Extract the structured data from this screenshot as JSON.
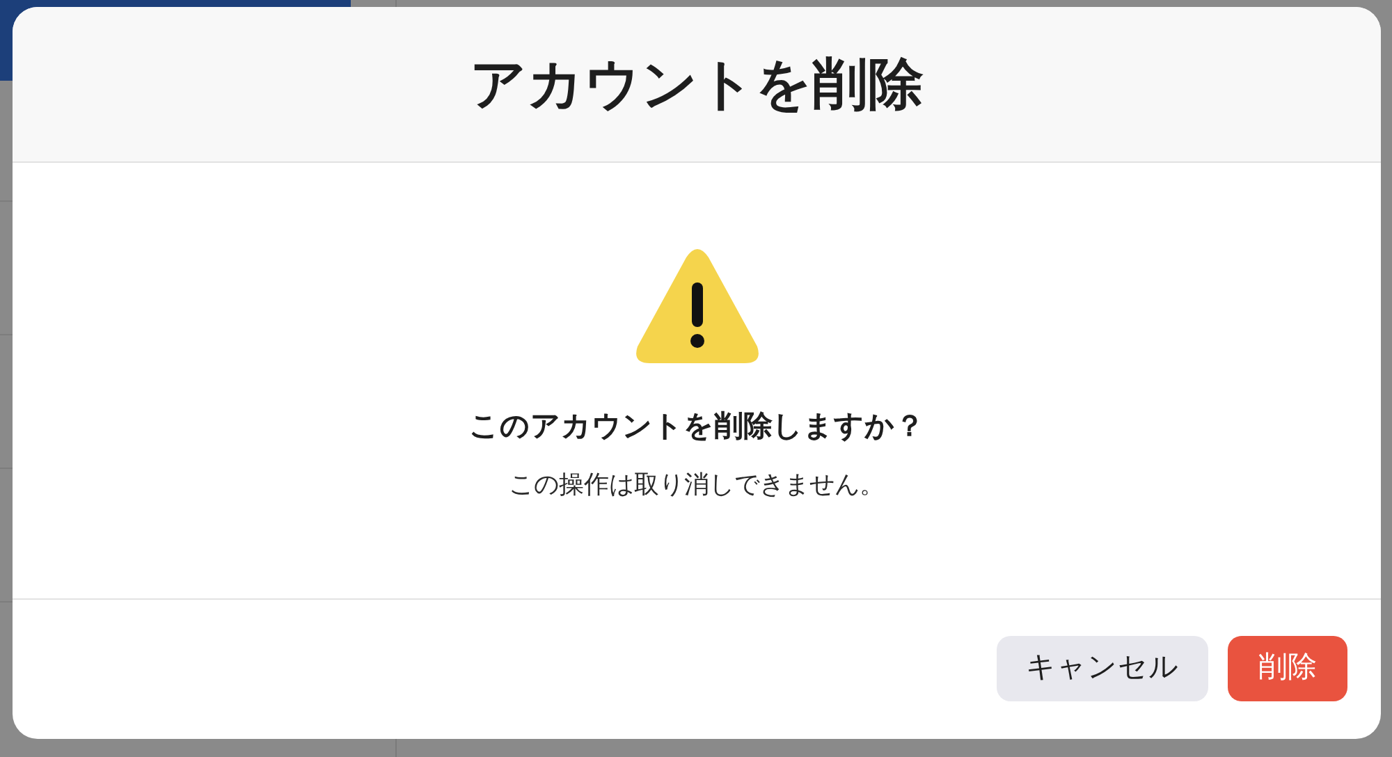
{
  "dialog": {
    "title": "アカウントを削除",
    "question": "このアカウントを削除しますか？",
    "message": "この操作は取り消しできません。",
    "buttons": [
      {
        "label": "キャンセル",
        "kind": "secondary"
      },
      {
        "label": "削除",
        "kind": "destructive"
      }
    ]
  }
}
